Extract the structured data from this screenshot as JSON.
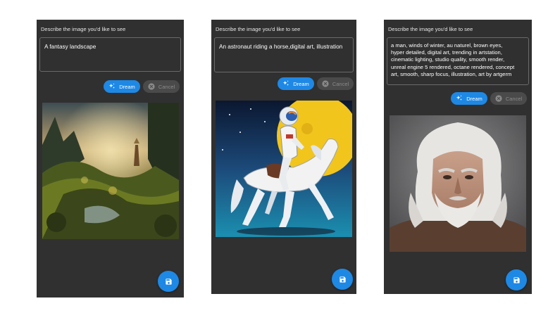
{
  "screens": [
    {
      "prompt_label": "Describe the image you'd like to see",
      "prompt_value": "A fantasy landscape",
      "dream_label": "Dream",
      "cancel_label": "Cancel",
      "image_subject": "fantasy-landscape-painting"
    },
    {
      "prompt_label": "Describe the image you'd like to see",
      "prompt_value": "An astronaut riding a horse,digital art, illustration",
      "dream_label": "Dream",
      "cancel_label": "Cancel",
      "image_subject": "astronaut-riding-horse"
    },
    {
      "prompt_label": "Describe the image you'd like to see",
      "prompt_value": "a man, winds of winter, au naturel, brown eyes,\nhyper detailed, digital art, trending in artstation,\ncinematic lighting, studio quality, smooth render,\nunreal engine 5 rendered, octane rendered, concept\nart, smooth, sharp focus, illustration, art by artgerm",
      "dream_label": "Dream",
      "cancel_label": "Cancel",
      "image_subject": "portrait-white-haired-man"
    }
  ],
  "icons": {
    "dream": "sparkle-icon",
    "cancel": "cancel-circle-icon",
    "save": "save-icon"
  },
  "colors": {
    "panel_bg": "#303030",
    "accent": "#1e88e5",
    "disabled_bg": "#4a4a4a",
    "disabled_text": "#8a8a8a"
  }
}
